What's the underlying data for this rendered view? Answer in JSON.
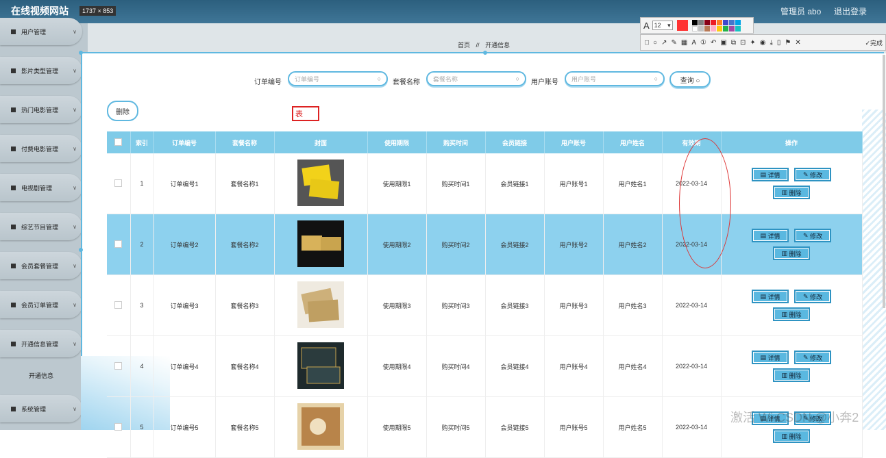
{
  "header": {
    "site_title": "在线视频网站",
    "dim_badge": "1737 × 853",
    "admin_label": "管理员 abo",
    "logout_label": "退出登录"
  },
  "sidebar": {
    "items": [
      {
        "label": "用户管理"
      },
      {
        "label": "影片类型管理"
      },
      {
        "label": "热门电影管理"
      },
      {
        "label": "付费电影管理"
      },
      {
        "label": "电视剧管理"
      },
      {
        "label": "综艺节目管理"
      },
      {
        "label": "会员套餐管理"
      },
      {
        "label": "会员订单管理"
      },
      {
        "label": "开通信息管理"
      },
      {
        "label": "系统管理"
      }
    ],
    "sub_item": "开通信息",
    "chevron": "∨"
  },
  "breadcrumb": {
    "home": "首页",
    "sep": "//",
    "current": "开通信息"
  },
  "search": {
    "order_label": "订单编号",
    "order_placeholder": "订单编号",
    "package_label": "套餐名称",
    "package_placeholder": "套餐名称",
    "account_label": "用户账号",
    "account_placeholder": "用户账号",
    "query_button": "查询 ○"
  },
  "toolbar": {
    "delete_button": "删除"
  },
  "annotation_text": "表",
  "table": {
    "headers": [
      "",
      "索引",
      "订单编号",
      "套餐名称",
      "封面",
      "使用期限",
      "购买时间",
      "会员链接",
      "用户账号",
      "用户姓名",
      "有效期",
      "操作"
    ],
    "rows": [
      {
        "index": "1",
        "order": "订单编号1",
        "package": "套餐名称1",
        "term": "使用期限1",
        "time": "购买时间1",
        "link": "会员链接1",
        "account": "用户账号1",
        "name": "用户姓名1",
        "valid": "2022-03-14"
      },
      {
        "index": "2",
        "order": "订单编号2",
        "package": "套餐名称2",
        "term": "使用期限2",
        "time": "购买时间2",
        "link": "会员链接2",
        "account": "用户账号2",
        "name": "用户姓名2",
        "valid": "2022-03-14"
      },
      {
        "index": "3",
        "order": "订单编号3",
        "package": "套餐名称3",
        "term": "使用期限3",
        "time": "购买时间3",
        "link": "会员链接3",
        "account": "用户账号3",
        "name": "用户姓名3",
        "valid": "2022-03-14"
      },
      {
        "index": "4",
        "order": "订单编号4",
        "package": "套餐名称4",
        "term": "使用期限4",
        "time": "购买时间4",
        "link": "会员链接4",
        "account": "用户账号4",
        "name": "用户姓名4",
        "valid": "2022-03-14"
      },
      {
        "index": "5",
        "order": "订单编号5",
        "package": "套餐名称5",
        "term": "使用期限5",
        "time": "购买时间5",
        "link": "会员链接5",
        "account": "用户账号5",
        "name": "用户姓名5",
        "valid": "2022-03-14"
      }
    ],
    "op_detail": "详情",
    "op_edit": "修改",
    "op_delete": "删除"
  },
  "screenshot_tool": {
    "font_size": "12",
    "current_color": "#ff3333",
    "palette": [
      "#000000",
      "#7f7f7f",
      "#880015",
      "#ed1c24",
      "#ff7f27",
      "#3f48cc",
      "#4477cc",
      "#00a2e8",
      "#ffffff",
      "#c3c3c3",
      "#b97a57",
      "#ffaec9",
      "#ffc90e",
      "#22b14c",
      "#a349a4",
      "#17c3c3"
    ],
    "finish_label": "完成"
  },
  "watermark": "激活 Wi CSDN @小奔2",
  "colors": {
    "accent": "#5fb8e0",
    "header_bg": "#7fcbe8",
    "highlight_row": "#8dd1ee"
  }
}
